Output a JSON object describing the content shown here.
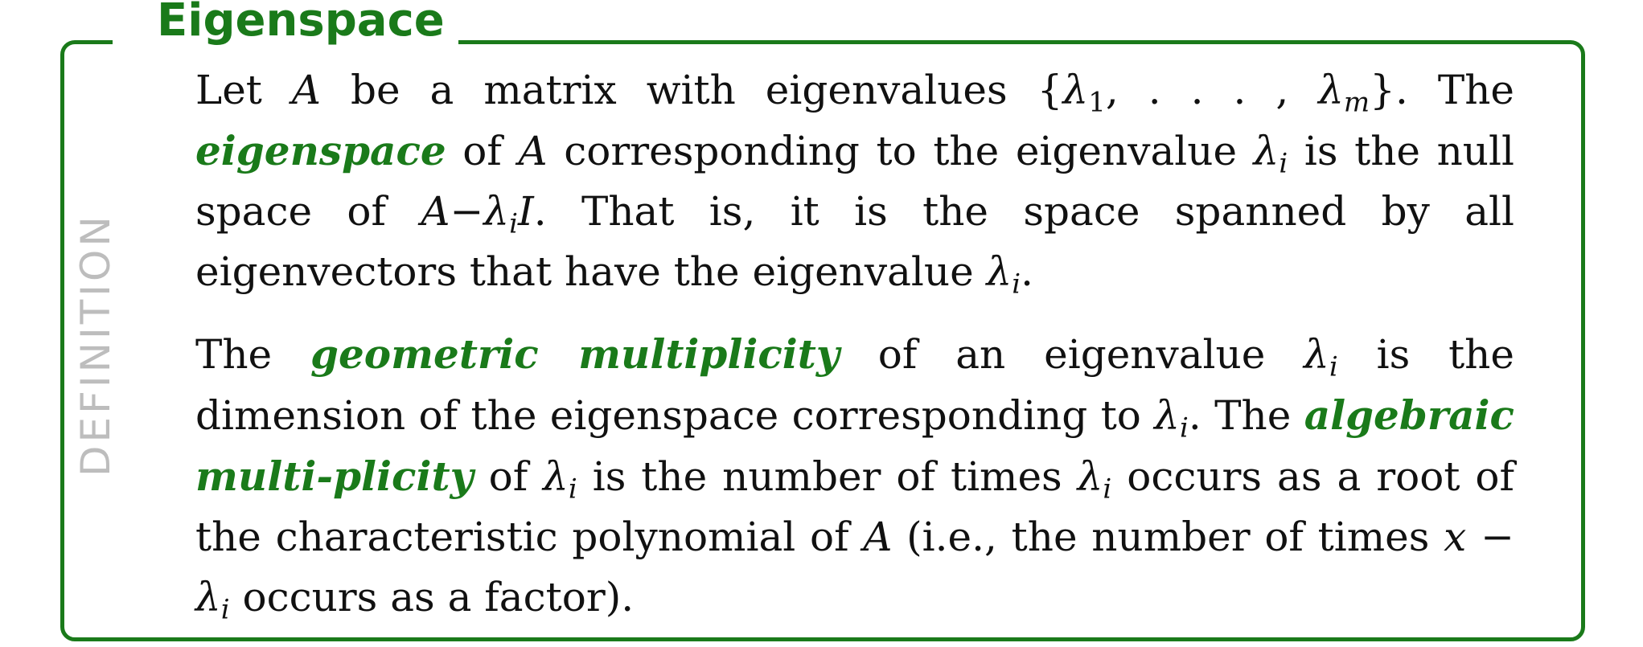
{
  "title": "Eigenspace",
  "side_label": "DEFINITION",
  "colors": {
    "accent": "#1a7a1a",
    "side_label": "#bdbdbd",
    "text": "#111111"
  },
  "p1": {
    "t1": "Let ",
    "A1": "A",
    "t2": " be a matrix with eigenvalues {",
    "lam1": "λ",
    "sub1": "1",
    "t3": ", . . . , ",
    "lamm": "λ",
    "subm": "m",
    "t4": "}. The ",
    "term1": "eigenspace",
    "t5": " of ",
    "A2": "A",
    "t6": " corresponding to the eigenvalue ",
    "lami1": "λ",
    "subi1": "i",
    "t7": " is the null space of ",
    "A3": "A",
    "t8": "−",
    "lami2": "λ",
    "subi2": "i",
    "I": "I",
    "t9": ". That is, it is the space spanned by all eigenvectors that have the eigenvalue ",
    "lami3": "λ",
    "subi3": "i",
    "t10": "."
  },
  "p2": {
    "t1": "The ",
    "term1": "geometric multiplicity",
    "t2": " of an eigenvalue ",
    "lami1": "λ",
    "subi1": "i",
    "t3": " is the dimension of the eigenspace corresponding to ",
    "lami2": "λ",
    "subi2": "i",
    "t4": ". The ",
    "term2": "algebraic multi-plicity",
    "t5": " of ",
    "lami3": "λ",
    "subi3": "i",
    "t6": " is the number of times ",
    "lami4": "λ",
    "subi4": "i",
    "t7": " occurs as a root of the characteristic polynomial of ",
    "A1": "A",
    "t8": " (i.e., the number of times ",
    "x": "x",
    "t9": " − ",
    "lami5": "λ",
    "subi5": "i",
    "t10": " occurs as a factor)."
  }
}
